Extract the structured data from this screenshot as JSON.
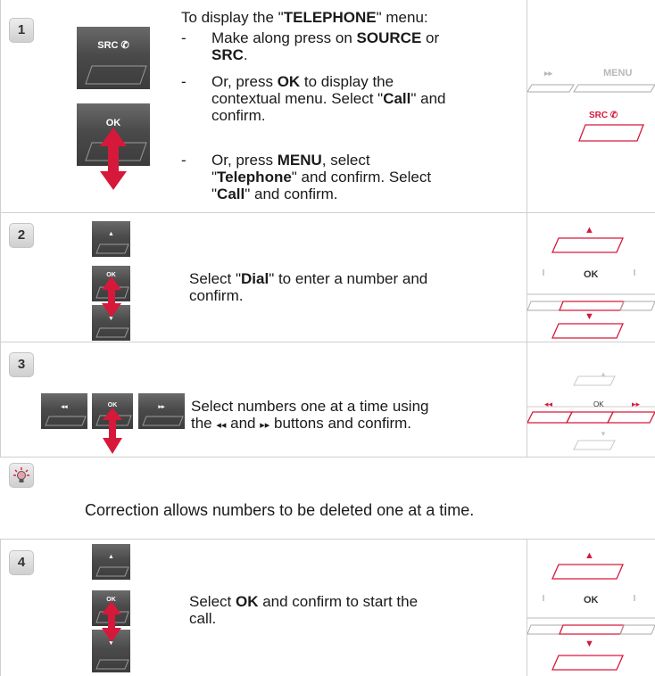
{
  "colors": {
    "accent_red": "#d6193a",
    "grid_line": "#cfcfcf",
    "button_dark": "#4a4a4a"
  },
  "step1": {
    "number": "1",
    "intro_pre": "To display the \"",
    "intro_bold": "TELEPHONE",
    "intro_post": "\" menu:",
    "bullets": [
      {
        "dash": "-",
        "l1_pre": "Make along press on ",
        "l1_b1": "SOURCE",
        "l1_mid": " or",
        "l2_b": "SRC",
        "l2_post": "."
      },
      {
        "dash": "-",
        "l1_pre": "Or, press ",
        "l1_b": "OK",
        "l1_post": " to display the",
        "l2_pre": "contextual menu. Select \"",
        "l2_b": "Call",
        "l2_post": "\" and",
        "l3": "confirm."
      },
      {
        "dash": "-",
        "l1_pre": "Or, press ",
        "l1_b": "MENU",
        "l1_post": ", select",
        "l2_pre": "\"",
        "l2_b": "Telephone",
        "l2_post": "\" and confirm. Select",
        "l3_pre": "\"",
        "l3_b": "Call",
        "l3_post": "\" and confirm."
      }
    ],
    "src_button_label": "SRC ✆",
    "ok_button_label": "OK",
    "panel": {
      "ff_label": "▸▸",
      "menu_label": "MENU",
      "src_label": "SRC ✆"
    }
  },
  "step2": {
    "number": "2",
    "text_pre": "Select \"",
    "text_b": "Dial",
    "text_post": "\" to enter a number and",
    "text_l2": "confirm.",
    "up_icon": "▲",
    "ok_label": "OK",
    "down_icon": "▼",
    "panel": {
      "ok_label": "OK",
      "up_icon": "▲",
      "down_icon": "▼"
    }
  },
  "step3": {
    "number": "3",
    "text_l1": "Select numbers one at a time using",
    "text_l2_a": "the ",
    "text_l2_rew": "◂◂",
    "text_l2_b": " and ",
    "text_l2_ff": "▸▸",
    "text_l2_c": " buttons and confirm.",
    "rew_label": "◂◂",
    "ok_label": "OK",
    "ff_label": "▸▸",
    "panel": {
      "ok_label": "OK",
      "up_icon": "▲",
      "down_icon": "▼",
      "rew_label": "◂◂",
      "ff_label": "▸▸"
    }
  },
  "tip": {
    "icon": "lightbulb-icon",
    "text": "Correction allows numbers to be deleted one at a time."
  },
  "step4": {
    "number": "4",
    "text_pre": "Select ",
    "text_b": "OK",
    "text_post": " and confirm to start the",
    "text_l2": "call.",
    "up_icon": "▲",
    "ok_label": "OK",
    "down_icon": "▼",
    "panel": {
      "ok_label": "OK",
      "up_icon": "▲",
      "down_icon": "▼"
    }
  }
}
